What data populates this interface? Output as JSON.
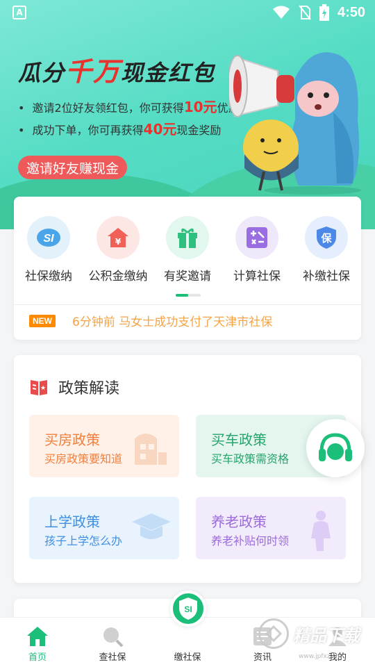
{
  "status_bar": {
    "left_icon": "A",
    "icons": [
      "wifi-icon",
      "no-sim-icon",
      "battery-icon"
    ],
    "time": "4:50"
  },
  "banner": {
    "title_prefix": "瓜分",
    "title_highlight": "千万",
    "title_suffix": "现金红包",
    "bullet1_pre": "邀请2位好友领红包，你可获得",
    "bullet1_amount": "10元",
    "bullet1_post": "优惠券",
    "bullet2_pre": "成功下单，你可再获得",
    "bullet2_amount": "40元",
    "bullet2_post": "现金奖励",
    "button": "邀请好友赚现金",
    "accent_color": "#e8322d"
  },
  "quick_menu": {
    "items": [
      {
        "label": "社保缴纳",
        "icon": "social-security-icon",
        "bg": "#e3f1fb",
        "color": "#4aa5e8"
      },
      {
        "label": "公积金缴纳",
        "icon": "house-fund-icon",
        "bg": "#fde7e5",
        "color": "#f06056"
      },
      {
        "label": "有奖邀请",
        "icon": "gift-icon",
        "bg": "#e2f7ee",
        "color": "#2fc07f"
      },
      {
        "label": "计算社保",
        "icon": "calculator-icon",
        "bg": "#efe8fb",
        "color": "#9a6ee0"
      },
      {
        "label": "补缴社保",
        "icon": "supplement-pay-icon",
        "bg": "#e5eefc",
        "color": "#4c88e8"
      }
    ],
    "news_badge": "NEW",
    "news_text": "6分钟前 马女士成功支付了天津市社保"
  },
  "policy": {
    "title": "政策解读",
    "tiles": [
      {
        "title": "买房政策",
        "subtitle": "买房政策要知道",
        "icon": "building-icon"
      },
      {
        "title": "买车政策",
        "subtitle": "买车政策需资格",
        "icon": "car-icon"
      },
      {
        "title": "上学政策",
        "subtitle": "孩子上学怎么办",
        "icon": "graduation-cap-icon"
      },
      {
        "title": "养老政策",
        "subtitle": "养老补贴何时领",
        "icon": "elderly-icon"
      }
    ]
  },
  "bottom_nav": {
    "items": [
      {
        "label": "首页",
        "icon": "home-icon",
        "active": true
      },
      {
        "label": "查社保",
        "icon": "search-icon",
        "active": false
      },
      {
        "label": "缴社保",
        "icon": "shield-si-icon",
        "active": false
      },
      {
        "label": "资讯",
        "icon": "news-icon",
        "active": false
      },
      {
        "label": "我的",
        "icon": "profile-icon",
        "active": false
      }
    ],
    "center_badge": "SI",
    "active_color": "#1bbf7a"
  },
  "watermark": {
    "text": "精品下载",
    "url": "www.jpfxz.cn"
  }
}
